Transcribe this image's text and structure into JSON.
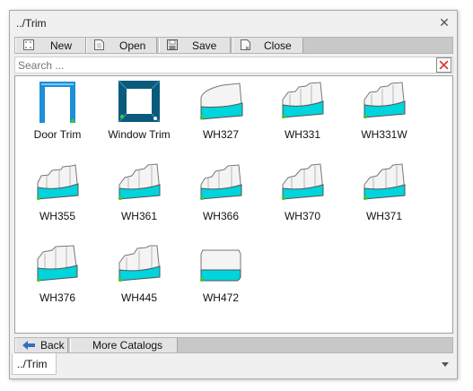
{
  "window": {
    "title": "../Trim"
  },
  "toolbar": {
    "new_label": "New",
    "open_label": "Open",
    "save_label": "Save",
    "close_label": "Close"
  },
  "search": {
    "placeholder": "Search ...",
    "value": ""
  },
  "items": [
    {
      "name": "Door Trim",
      "icon": "door-trim-icon"
    },
    {
      "name": "Window Trim",
      "icon": "window-trim-icon"
    },
    {
      "name": "WH327",
      "icon": "trim-profile-icon"
    },
    {
      "name": "WH331",
      "icon": "trim-profile-icon"
    },
    {
      "name": "WH331W",
      "icon": "trim-profile-icon"
    },
    {
      "name": "WH355",
      "icon": "trim-profile-icon"
    },
    {
      "name": "WH361",
      "icon": "trim-profile-icon"
    },
    {
      "name": "WH366",
      "icon": "trim-profile-icon"
    },
    {
      "name": "WH370",
      "icon": "trim-profile-icon"
    },
    {
      "name": "WH371",
      "icon": "trim-profile-icon"
    },
    {
      "name": "WH376",
      "icon": "trim-profile-icon"
    },
    {
      "name": "WH445",
      "icon": "trim-profile-icon"
    },
    {
      "name": "WH472",
      "icon": "trim-profile-icon"
    }
  ],
  "bottom": {
    "back_label": "Back",
    "more_label": "More Catalogs"
  },
  "tabs": [
    {
      "label": "../Trim"
    }
  ],
  "colors": {
    "accent_cyan": "#00d4dc",
    "trim_blue": "#1c8fd6",
    "window_navy": "#0b5a7c",
    "node_green": "#3cc83c",
    "close_red": "#d83b3b"
  }
}
